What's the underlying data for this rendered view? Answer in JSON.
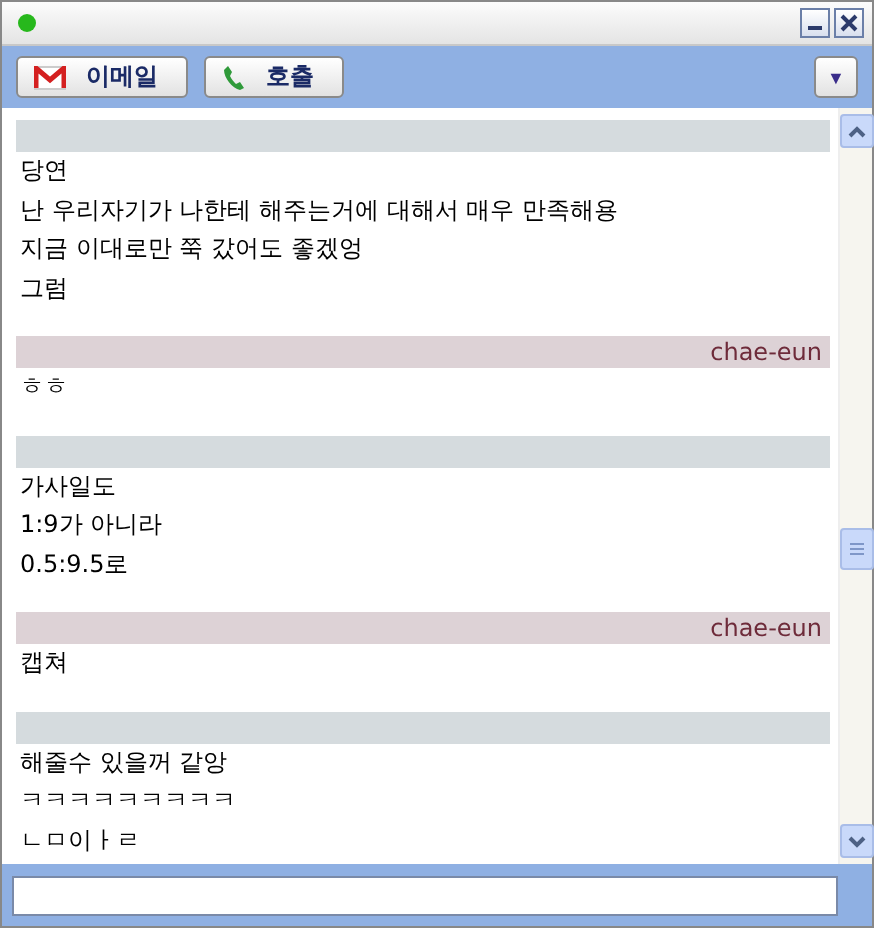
{
  "window": {
    "online": true
  },
  "toolbar": {
    "buttons": [
      {
        "kind": "email",
        "label": "이메일"
      },
      {
        "kind": "call",
        "label": "호출"
      }
    ],
    "menu_arrow": "▼"
  },
  "messages": [
    {
      "kind": "self",
      "lines": [
        "당연",
        "난 우리자기가 나한테 해주는거에 대해서 매우 만족해용",
        "지금 이대로만 쭉 갔어도 좋겠엉",
        "그럼"
      ]
    },
    {
      "kind": "other",
      "name": "chae-eun",
      "lines": [
        "ㅎㅎ"
      ]
    },
    {
      "kind": "self",
      "lines": [
        "가사일도",
        "1:9가 아니라",
        "0.5:9.5로"
      ]
    },
    {
      "kind": "other",
      "name": "chae-eun",
      "lines": [
        "캡쳐"
      ]
    },
    {
      "kind": "self",
      "lines": [
        "해줄수 있을꺼 같앙",
        "ㅋㅋㅋㅋㅋㅋㅋㅋㅋ",
        "ㄴㅁ이ㅏㄹ"
      ]
    }
  ]
}
